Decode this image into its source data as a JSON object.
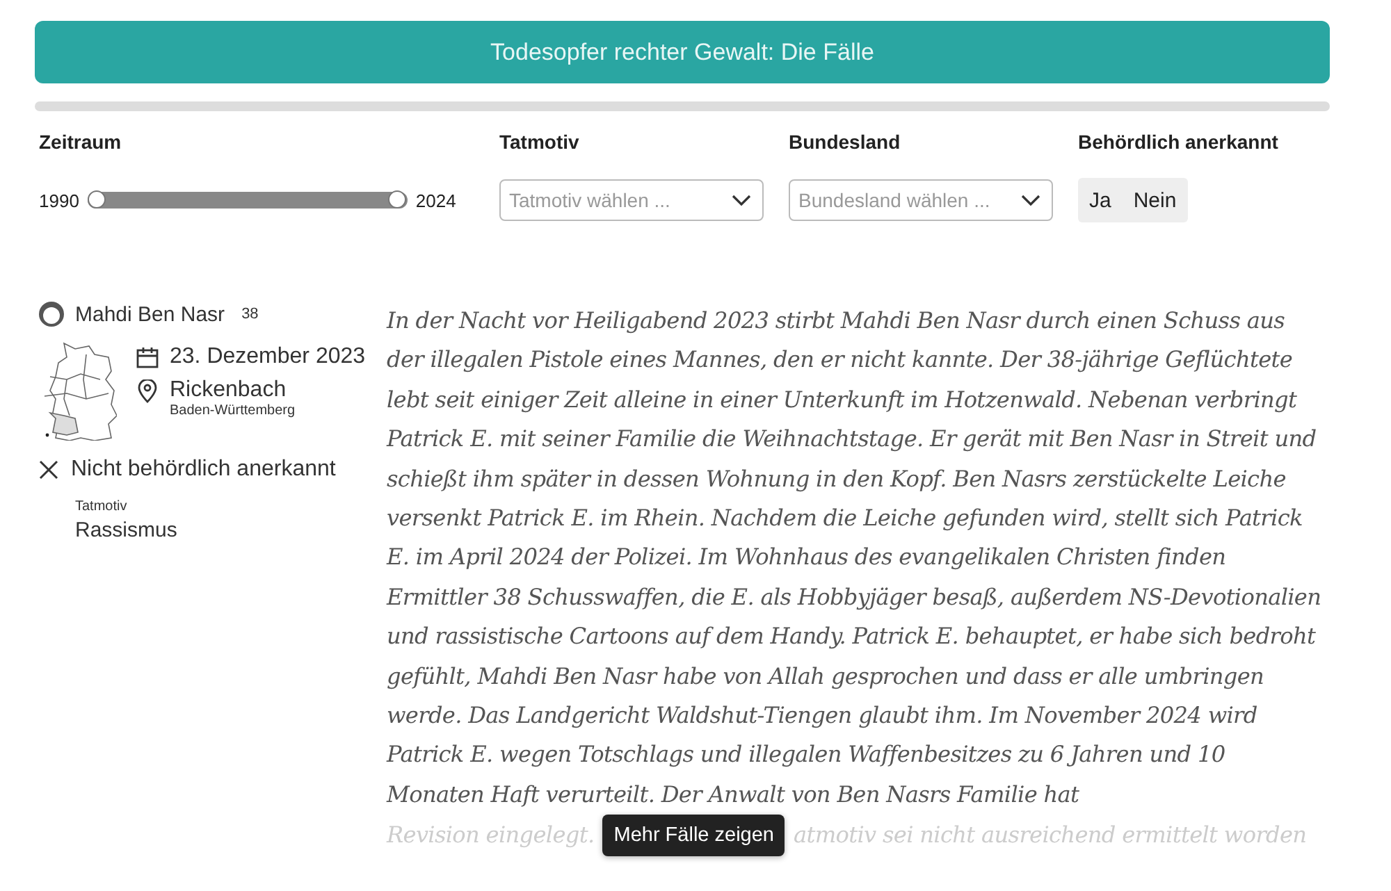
{
  "header": {
    "title": "Todesopfer rechter Gewalt: Die Fälle"
  },
  "filters": {
    "period": {
      "label": "Zeitraum",
      "from": "1990",
      "to": "2024",
      "level": 1
    },
    "motive": {
      "label": "Tatmotiv",
      "placeholder": "Tatmotiv wählen ..."
    },
    "state": {
      "label": "Bundesland",
      "placeholder": "Bundesland wählen ..."
    },
    "recognized": {
      "label": "Behördlich anerkannt",
      "options": [
        {
          "label": "Ja",
          "selected": false
        },
        {
          "label": "Nein",
          "selected": false
        }
      ]
    }
  },
  "case": {
    "name": "Mahdi Ben Nasr",
    "age": "38",
    "date": "23. Dezember 2023",
    "place": "Rickenbach",
    "region": "Baden-Württemberg",
    "recognized": false,
    "recognition_text": "Nicht behördlich anerkannt",
    "motive_label": "Tatmotiv",
    "motive": "Rassismus",
    "text": "In der Nacht vor Heiligabend 2023 stirbt Mahdi Ben Nasr durch einen Schuss aus der illegalen Pistole eines Mannes, den er nicht kannte. Der 38-jährige Geflüchtete lebt seit einiger Zeit alleine in einer Unterkunft im Hotzenwald. Nebenan verbringt Patrick E. mit seiner Familie die Weihnachtstage. Er gerät mit Ben Nasr in Streit und schießt ihm später in dessen Wohnung in den Kopf. Ben Nasrs zerstückelte Leiche versenkt Patrick E. im Rhein. Nachdem die Leiche gefunden wird, stellt sich Patrick E. im April 2024 der Polizei. Im Wohnhaus des evangelikalen Christen finden Ermittler 38 Schusswaffen, die E. als Hobbyjäger besaß, außerdem NS-Devotionalien und rassistische Cartoons auf dem Handy. Patrick E. behauptet, er habe sich bedroht gefühlt, Mahdi Ben Nasr habe von Allah gesprochen und dass er alle umbringen werde. Das Landgericht Waldshut-Tiengen glaubt ihm. Im November 2024 wird Patrick E. wegen Totschlags und illegalen Waffenbesitzes zu 6 Jahren und 10 Monaten Haft verurteilt. Der Anwalt von Ben Nasrs Familie hat",
    "faded_start": "Revision eingelegt.",
    "faded_end": "atmotiv sei nicht ausreichend ermittelt worden"
  },
  "more_button": "Mehr Fälle zeigen"
}
